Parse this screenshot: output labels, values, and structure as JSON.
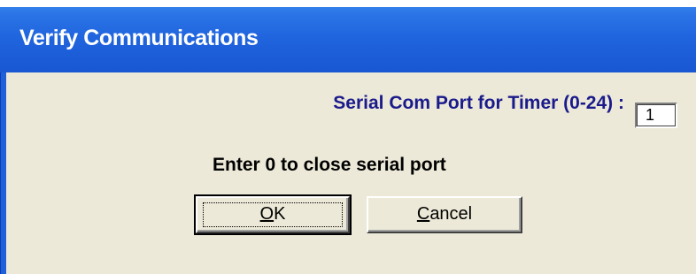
{
  "window": {
    "title": "Verify Communications"
  },
  "form": {
    "port_label": "Serial Com Port for Timer (0-24) :",
    "port_value": "1",
    "hint": "Enter 0 to close serial port"
  },
  "buttons": {
    "ok_label": "OK",
    "ok_mnemonic": "O",
    "cancel_label": "Cancel",
    "cancel_mnemonic": "C"
  },
  "colors": {
    "title_bar": "#1f63dd",
    "dialog_face": "#ece9d8",
    "label_text": "#1a1a8c"
  }
}
